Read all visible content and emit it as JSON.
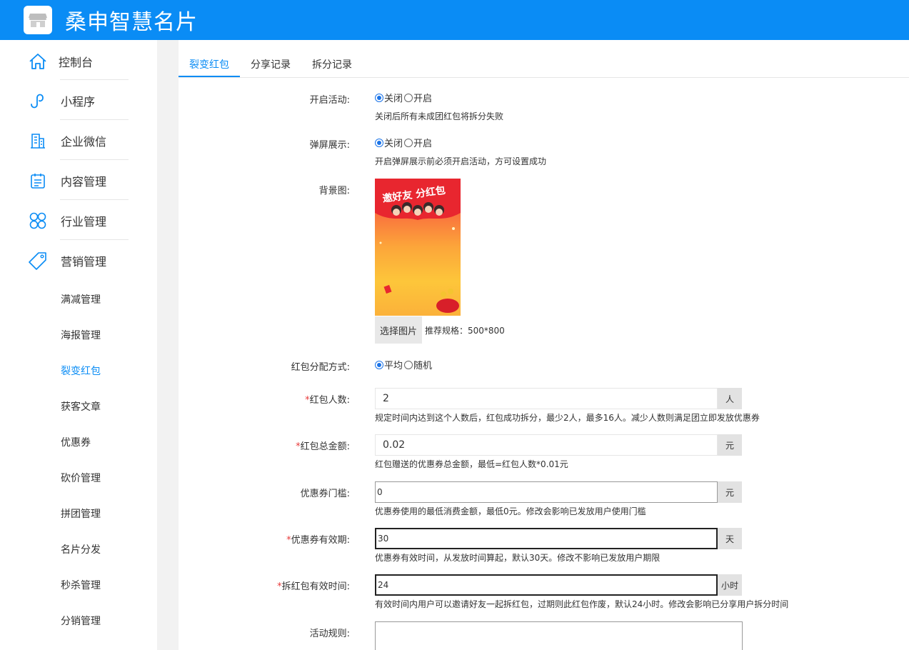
{
  "app": {
    "title": "桑申智慧名片"
  },
  "sidebar": {
    "items": [
      {
        "label": "控制台"
      },
      {
        "label": "小程序"
      },
      {
        "label": "企业微信"
      },
      {
        "label": "内容管理"
      },
      {
        "label": "行业管理"
      },
      {
        "label": "营销管理"
      }
    ],
    "sub_items": [
      {
        "label": "满减管理"
      },
      {
        "label": "海报管理"
      },
      {
        "label": "裂变红包"
      },
      {
        "label": "获客文章"
      },
      {
        "label": "优惠券"
      },
      {
        "label": "砍价管理"
      },
      {
        "label": "拼团管理"
      },
      {
        "label": "名片分发"
      },
      {
        "label": "秒杀管理"
      },
      {
        "label": "分销管理"
      }
    ],
    "active_sub": "裂变红包"
  },
  "tabs": [
    {
      "label": "裂变红包"
    },
    {
      "label": "分享记录"
    },
    {
      "label": "拆分记录"
    }
  ],
  "form": {
    "activity": {
      "label": "开启活动:",
      "options": [
        "关闭",
        "开启"
      ],
      "selected": "关闭",
      "hint": "关闭后所有未成团红包将拆分失败"
    },
    "popup": {
      "label": "弹屏展示:",
      "options": [
        "关闭",
        "开启"
      ],
      "selected": "关闭",
      "hint": "开启弹屏展示前必须开启活动，方可设置成功"
    },
    "background": {
      "label": "背景图:",
      "image_text": "邀好友 分红包",
      "button": "选择图片",
      "spec": "推荐规格：500*800"
    },
    "distribution": {
      "label": "红包分配方式:",
      "options": [
        "平均",
        "随机"
      ],
      "selected": "平均"
    },
    "count": {
      "required": "*",
      "label": "红包人数:",
      "value": "2",
      "unit": "人",
      "hint": "规定时间内达到这个人数后，红包成功拆分，最少2人，最多16人。减少人数则满足团立即发放优惠券"
    },
    "amount": {
      "required": "*",
      "label": "红包总金额:",
      "value": "0.02",
      "unit": "元",
      "hint": "红包赠送的优惠券总金额，最低=红包人数*0.01元"
    },
    "threshold": {
      "label": "优惠券门槛:",
      "value": "0",
      "unit": "元",
      "hint": "优惠券使用的最低消费金额，最低0元。修改会影响已发放用户使用门槛"
    },
    "validity": {
      "required": "*",
      "label": "优惠券有效期:",
      "value": "30",
      "unit": "天",
      "hint": "优惠券有效时间，从发放时间算起，默认30天。修改不影响已发放用户期限"
    },
    "split_time": {
      "required": "*",
      "label": "拆红包有效时间:",
      "value": "24",
      "unit": "小时",
      "hint": "有效时间内用户可以邀请好友一起拆红包，过期则此红包作废，默认24小时。修改会影响已分享用户拆分时间"
    },
    "rules": {
      "label": "活动规则:"
    }
  }
}
